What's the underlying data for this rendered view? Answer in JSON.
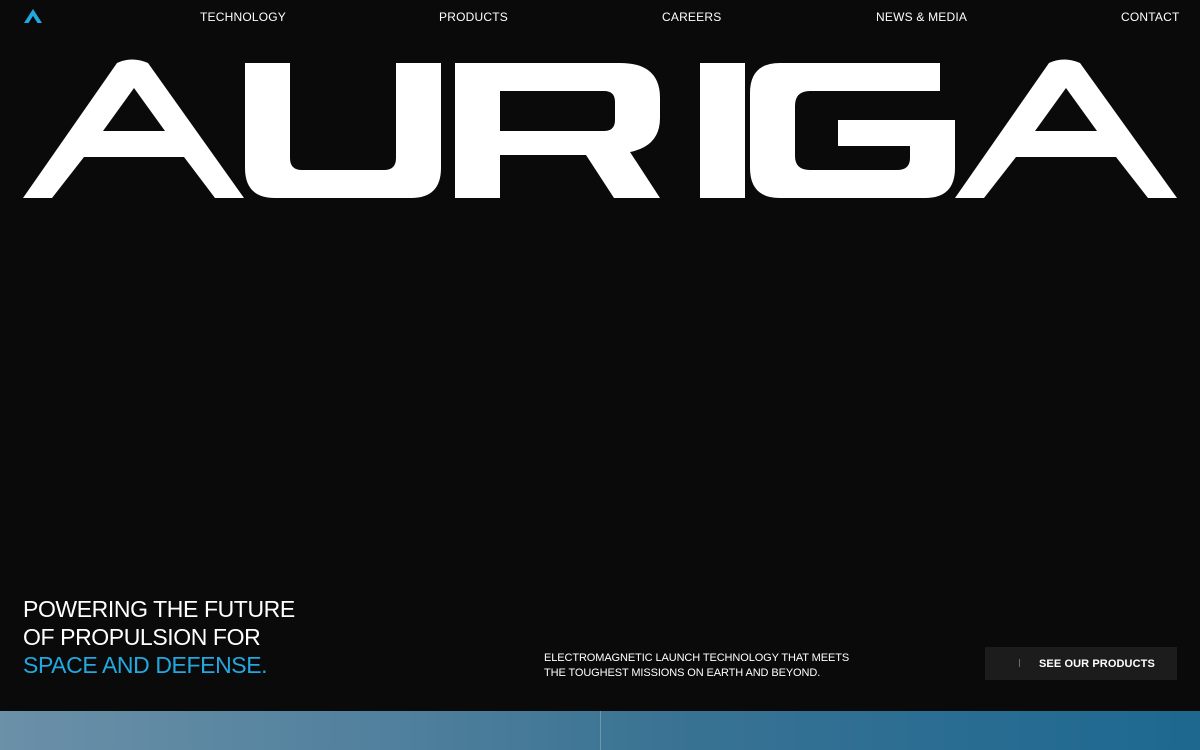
{
  "brand": {
    "wordmark": "AURIGA",
    "logo_icon": "triangle-logo-icon",
    "accent_color": "#22a8e0"
  },
  "nav": {
    "items": [
      {
        "label": "TECHNOLOGY"
      },
      {
        "label": "PRODUCTS"
      },
      {
        "label": "CAREERS"
      },
      {
        "label": "NEWS & MEDIA"
      },
      {
        "label": "CONTACT"
      }
    ]
  },
  "hero": {
    "tagline": {
      "line1": "POWERING THE FUTURE",
      "line2": "OF PROPULSION FOR",
      "line3_accent": "SPACE AND DEFENSE."
    },
    "description": {
      "line1": "ELECTROMAGNETIC LAUNCH TECHNOLOGY THAT MEETS",
      "line2": "THE TOUGHEST MISSIONS ON EARTH AND BEYOND."
    },
    "cta": {
      "label": "SEE OUR PRODUCTS",
      "icon": "bar-icon"
    }
  }
}
